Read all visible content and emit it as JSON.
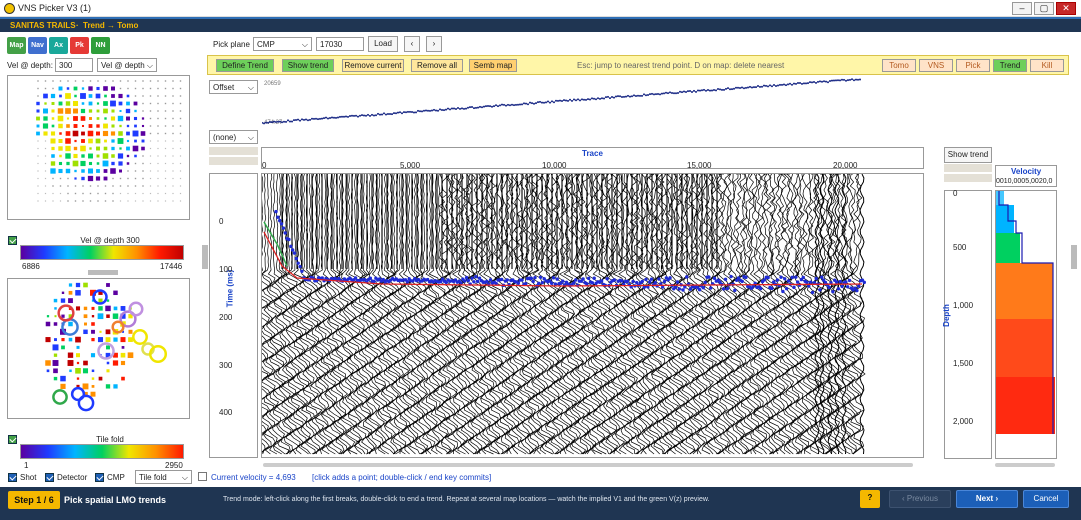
{
  "window": {
    "title": "VNS Picker V3   (1)",
    "min": "–",
    "max": "▢",
    "close": "✕"
  },
  "brand": {
    "name": "SANITAS TRAILS",
    "breadcrumb": "Trend → Tomo"
  },
  "tools": [
    {
      "label": "Map",
      "color": "#43a047"
    },
    {
      "label": "Nav",
      "color": "#3f6fcf"
    },
    {
      "label": "Ax",
      "color": "#1aa89a"
    },
    {
      "label": "Pk",
      "color": "#e53935"
    },
    {
      "label": "NN",
      "color": "#2e9e3a"
    }
  ],
  "vel": {
    "label": "Vel @ depth:",
    "value": "300",
    "mode": "Vel @ depth"
  },
  "colorbar1": {
    "title": "Vel @ depth 300",
    "min": "6886",
    "max": "17446"
  },
  "colorbar2": {
    "title": "Tile fold",
    "min": "1",
    "max": "2950"
  },
  "pickplane": {
    "label": "Pick plane",
    "type": "CMP",
    "value": "17030",
    "load": "Load",
    "prev": "‹",
    "next": "›"
  },
  "toolbar": {
    "define": "Define Trend",
    "show": "Show trend",
    "remove": "Remove current",
    "removeall": "Remove all",
    "semb": "Semb map",
    "hint": "Esc: jump to nearest trend point.   D on map: delete nearest",
    "tomo": "Tomo",
    "vns": "VNS",
    "pick": "Pick",
    "trend": "Trend",
    "kill": "Kill"
  },
  "header": {
    "attr": "Offset",
    "attr2": "(none)",
    "max": "20659",
    "min": "474.37"
  },
  "trace": {
    "title": "Trace",
    "ticks": [
      "0",
      "5,000",
      "10,000",
      "15,000",
      "20,000"
    ]
  },
  "time": {
    "label": "Time (ms)",
    "ticks": [
      "0",
      "100",
      "200",
      "300",
      "400"
    ]
  },
  "right": {
    "showtrend": "Show trend",
    "velocity": "Velocity",
    "veltick": "0010,0005,0020,0",
    "depth": "Depth",
    "depthticks": [
      "0",
      "500",
      "1,000",
      "1,500",
      "2,000"
    ]
  },
  "status": {
    "shot": "Shot",
    "detector": "Detector",
    "cmp": "CMP",
    "fold": "Tile fold",
    "velocity": "Current velocity = 4,693",
    "hint": "[click adds a point; double-click / end key commits]"
  },
  "footer": {
    "step": "Step 1 / 6",
    "title": "Pick spatial LMO trends",
    "desc": "Trend mode: left-click along the first breaks, double-click to end a trend. Repeat at several map locations — watch the implied V1 and the green V(z) preview.",
    "help": "?",
    "previous": "‹ Previous",
    "next": "Next ›",
    "cancel": "Cancel"
  }
}
